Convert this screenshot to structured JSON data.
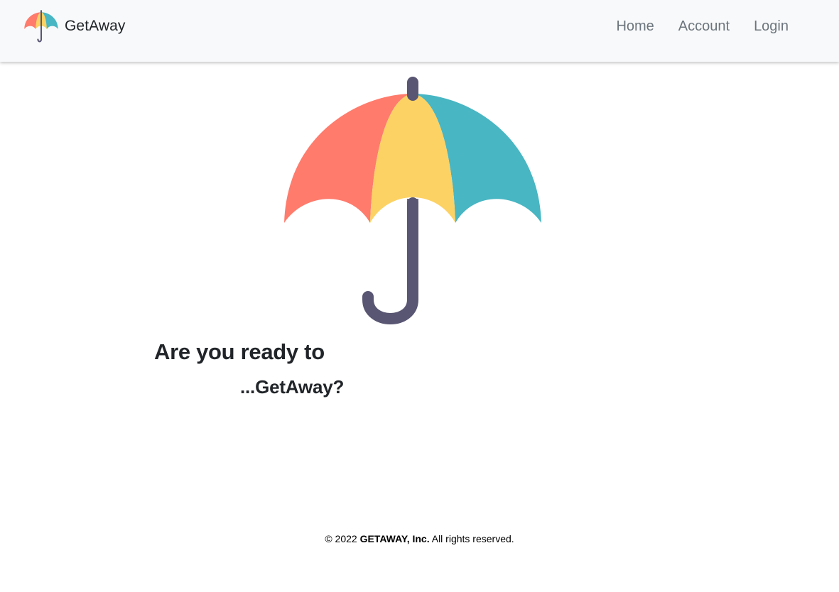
{
  "navbar": {
    "brand_name": "GetAway",
    "brand_icon": "umbrella-icon",
    "links": [
      {
        "label": "Home"
      },
      {
        "label": "Account"
      },
      {
        "label": "Login"
      }
    ]
  },
  "hero": {
    "image_icon": "umbrella-icon",
    "line1": "Are you ready to",
    "line2": "...GetAway?"
  },
  "footer": {
    "prefix": "© 2022",
    "company": "GETAWAY, Inc.",
    "suffix": "All rights reserved."
  },
  "colors": {
    "navbar_bg": "#f8f9fa",
    "umbrella_red": "#ff7b6c",
    "umbrella_yellow": "#fdd264",
    "umbrella_teal": "#48b6c3",
    "umbrella_handle": "#595673",
    "nav_link": "#6c757d",
    "text": "#212529"
  }
}
